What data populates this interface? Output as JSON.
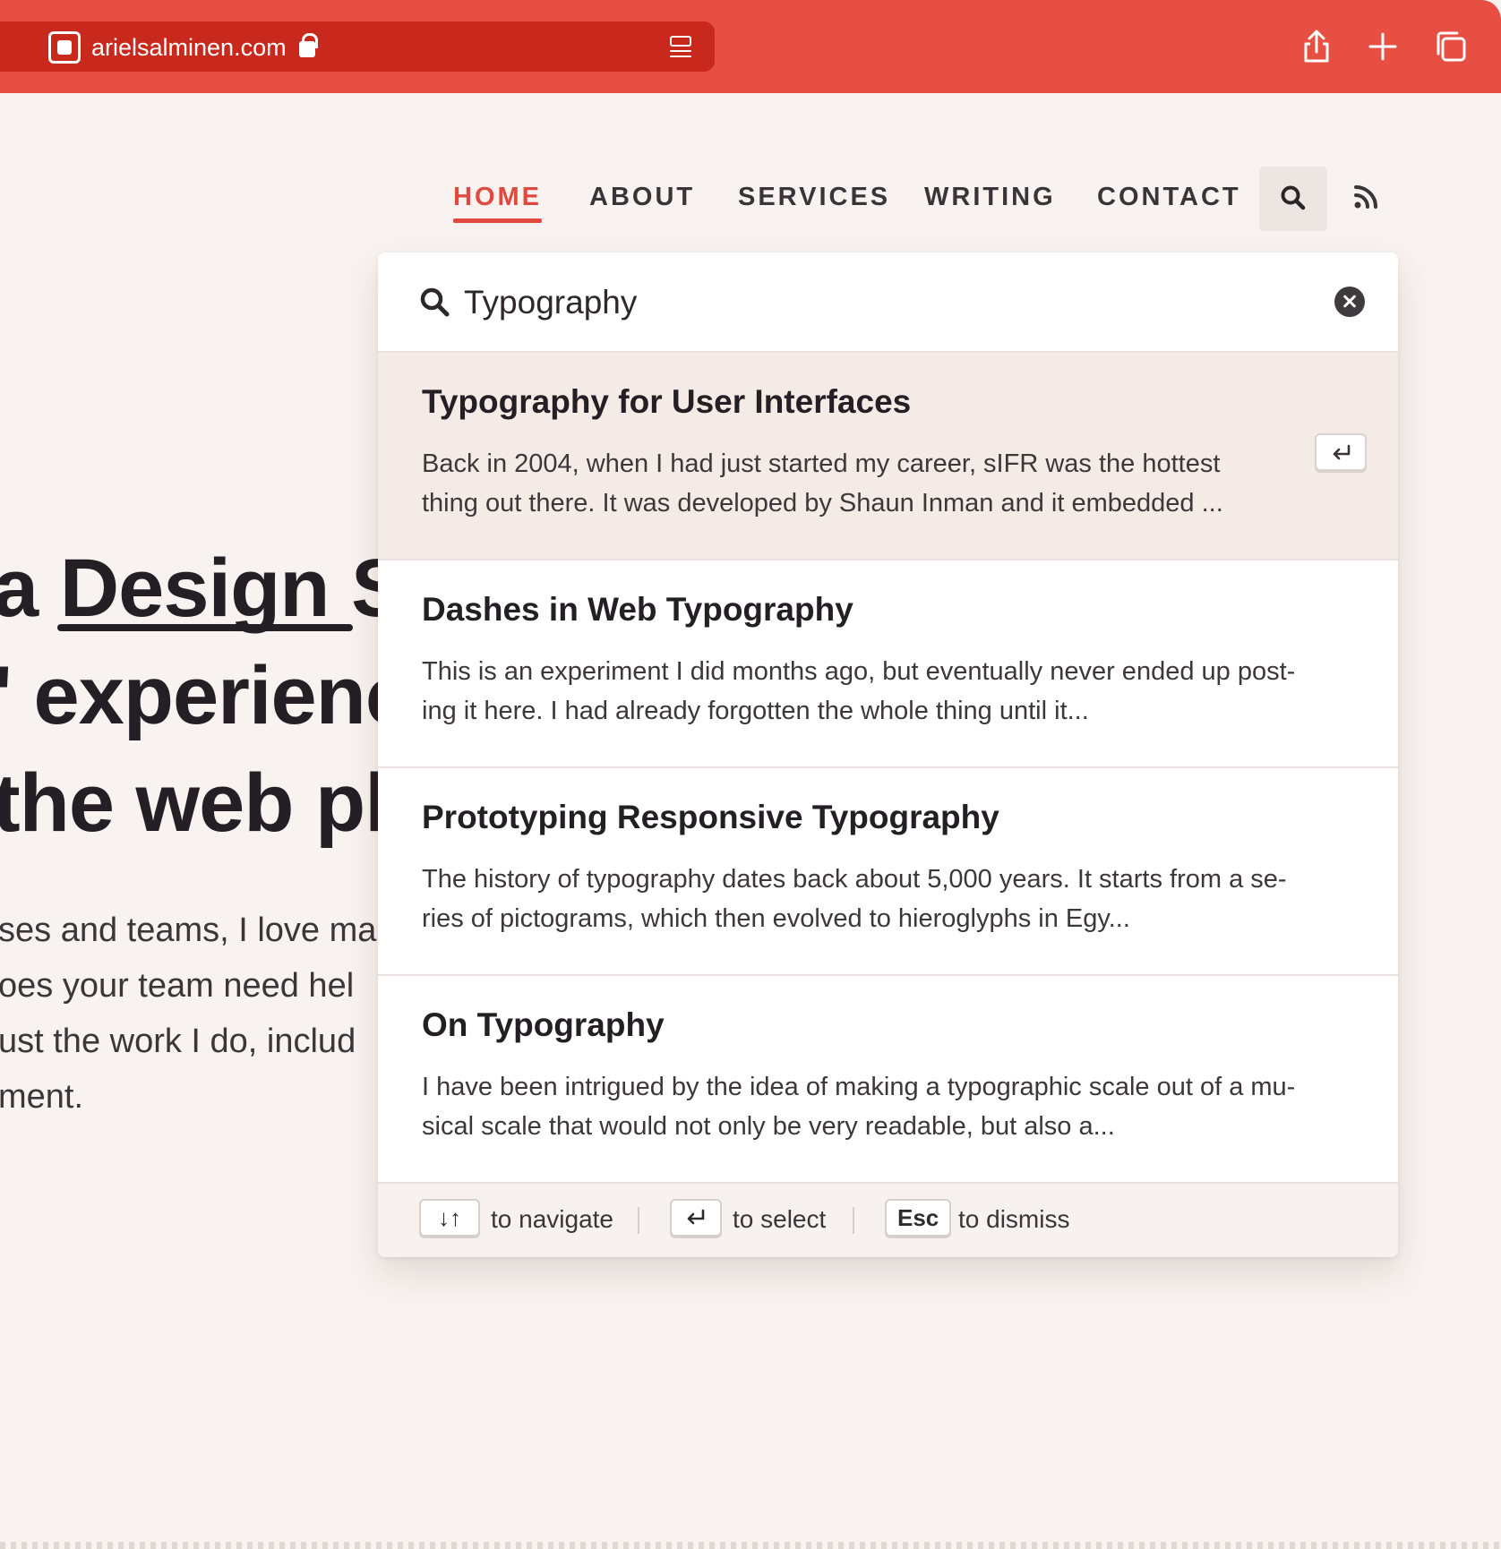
{
  "browser": {
    "url": "arielsalminen.com"
  },
  "nav": {
    "items": [
      {
        "label": "HOME",
        "active": true
      },
      {
        "label": "ABOUT",
        "active": false
      },
      {
        "label": "SERVICES",
        "active": false
      },
      {
        "label": "WRITING",
        "active": false
      },
      {
        "label": "CONTACT",
        "active": false
      }
    ]
  },
  "hero": {
    "line1_prefix": "a ",
    "line1_underlined": "Design Sy",
    "line2": "' experience",
    "line3": "the web pla",
    "body": [
      "ses and teams, I love ma",
      "oes your team need hel",
      "ust the work I do, includ",
      "ment."
    ]
  },
  "search": {
    "query": "Typography",
    "results": [
      {
        "title": "Typography for User Interfaces",
        "excerpt": "Back in 2004, when I had just started my career, sIFR was the hottest thing out there. It was developed by Shaun Inman and it embedded ...",
        "selected": true
      },
      {
        "title": "Dashes in Web Typography",
        "excerpt": "This is an experiment I did months ago, but eventually never ended up post-ing it here. I had already forgotten the whole thing until it...",
        "selected": false
      },
      {
        "title": "Prototyping Responsive Typography",
        "excerpt": "The history of typography dates back about 5,000 years. It starts from a se-ries of pictograms, which then evolved to hieroglyphs in Egy...",
        "selected": false
      },
      {
        "title": "On Typography",
        "excerpt": "I have been intrigued by the idea of making a typographic scale out of a mu-sical scale that would not only be very readable, but also a...",
        "selected": false
      }
    ],
    "footer": {
      "navigate_key": "↓↑",
      "navigate_label": "to navigate",
      "select_label": "to select",
      "dismiss_key": "Esc",
      "dismiss_label": "to dismiss"
    }
  },
  "colors": {
    "toolbar": "#e64f42",
    "address_bar": "#c8291c",
    "accent": "#e04a3e",
    "page_bg": "#f8f3f0",
    "selected_result_bg": "#f5ebe6"
  },
  "icons": {
    "toolbar": [
      "site-favicon-icon",
      "lock-icon",
      "reader-icon",
      "share-icon",
      "new-tab-icon",
      "tabs-icon"
    ],
    "nav": [
      "search-icon",
      "rss-icon"
    ],
    "search": [
      "magnifier-icon",
      "clear-icon",
      "return-key-icon"
    ]
  }
}
